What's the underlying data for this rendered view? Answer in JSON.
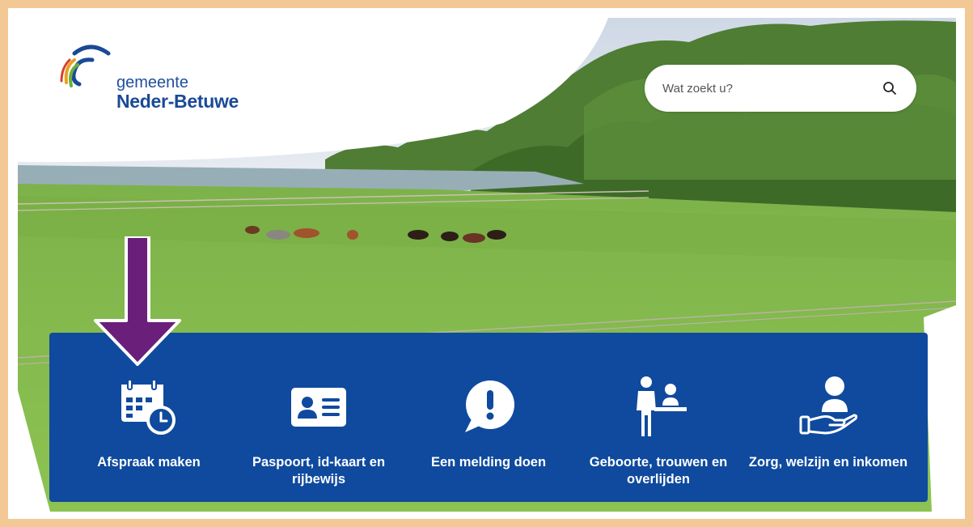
{
  "brand": {
    "name_small": "gemeente",
    "name_big": "Neder-Betuwe",
    "colors": {
      "primary": "#0f4a9e",
      "frame": "#f2c894",
      "arrow": "#6a1f7a"
    }
  },
  "search": {
    "placeholder": "Wat zoekt u?",
    "icon": "search-icon"
  },
  "tiles": [
    {
      "label": "Afspraak maken",
      "icon": "calendar-clock-icon"
    },
    {
      "label": "Paspoort, id-kaart en rijbewijs",
      "icon": "id-card-icon"
    },
    {
      "label": "Een melding doen",
      "icon": "exclamation-bubble-icon"
    },
    {
      "label": "Geboorte, trouwen en overlijden",
      "icon": "people-counter-icon"
    },
    {
      "label": "Zorg, welzijn en inkomen",
      "icon": "hand-person-icon"
    }
  ],
  "annotation": {
    "icon": "down-arrow-icon"
  }
}
